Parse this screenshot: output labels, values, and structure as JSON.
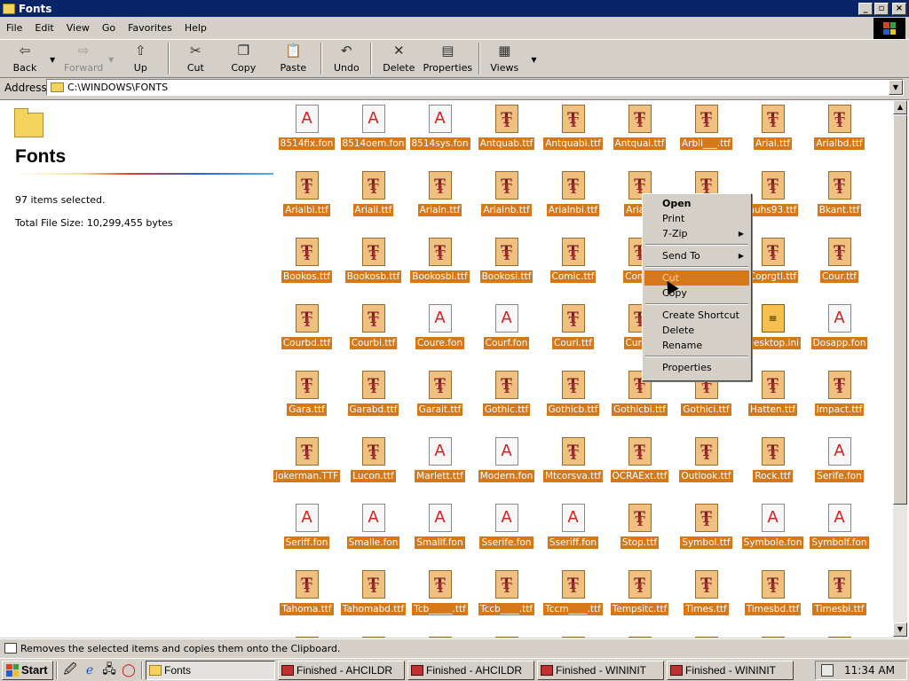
{
  "window": {
    "title": "Fonts"
  },
  "menu": [
    "File",
    "Edit",
    "View",
    "Go",
    "Favorites",
    "Help"
  ],
  "toolbar": {
    "back": "Back",
    "forward": "Forward",
    "up": "Up",
    "cut": "Cut",
    "copy": "Copy",
    "paste": "Paste",
    "undo": "Undo",
    "delete": "Delete",
    "properties": "Properties",
    "views": "Views"
  },
  "address": {
    "label": "Address",
    "value": "C:\\WINDOWS\\FONTS"
  },
  "left_pane": {
    "title": "Fonts",
    "selected": "97 items selected.",
    "total_size": "Total File Size: 10,299,455 bytes"
  },
  "files": [
    {
      "name": "8514fix.fon",
      "type": "fon"
    },
    {
      "name": "8514oem.fon",
      "type": "fon"
    },
    {
      "name": "8514sys.fon",
      "type": "fon"
    },
    {
      "name": "Antquab.ttf",
      "type": "ttf"
    },
    {
      "name": "Antquabi.ttf",
      "type": "ttf"
    },
    {
      "name": "Antquai.ttf",
      "type": "ttf"
    },
    {
      "name": "Arbli___.ttf",
      "type": "ttf"
    },
    {
      "name": "Arial.ttf",
      "type": "ttf"
    },
    {
      "name": "Arialbd.ttf",
      "type": "ttf"
    },
    {
      "name": "Arialbi.ttf",
      "type": "ttf"
    },
    {
      "name": "Ariali.ttf",
      "type": "ttf"
    },
    {
      "name": "Arialn.ttf",
      "type": "ttf"
    },
    {
      "name": "Arialnb.ttf",
      "type": "ttf"
    },
    {
      "name": "Arialnbi.ttf",
      "type": "ttf"
    },
    {
      "name": "Arialn",
      "type": "ttf"
    },
    {
      "name": "",
      "type": "ttf"
    },
    {
      "name": "auhs93.ttf",
      "type": "ttf"
    },
    {
      "name": "Bkant.ttf",
      "type": "ttf"
    },
    {
      "name": "Bookos.ttf",
      "type": "ttf"
    },
    {
      "name": "Bookosb.ttf",
      "type": "ttf"
    },
    {
      "name": "Bookosbi.ttf",
      "type": "ttf"
    },
    {
      "name": "Bookosi.ttf",
      "type": "ttf"
    },
    {
      "name": "Comic.ttf",
      "type": "ttf"
    },
    {
      "name": "Comic",
      "type": "ttf"
    },
    {
      "name": "",
      "type": "ttf"
    },
    {
      "name": "Coprgtl.ttf",
      "type": "ttf"
    },
    {
      "name": "Cour.ttf",
      "type": "ttf"
    },
    {
      "name": "Courbd.ttf",
      "type": "ttf"
    },
    {
      "name": "Courbi.ttf",
      "type": "ttf"
    },
    {
      "name": "Coure.fon",
      "type": "fon"
    },
    {
      "name": "Courf.fon",
      "type": "fon"
    },
    {
      "name": "Couri.ttf",
      "type": "ttf"
    },
    {
      "name": "Curlz_",
      "type": "ttf"
    },
    {
      "name": "",
      "type": "ttf"
    },
    {
      "name": "Desktop.ini",
      "type": "ini"
    },
    {
      "name": "Dosapp.fon",
      "type": "fon"
    },
    {
      "name": "Gara.ttf",
      "type": "ttf"
    },
    {
      "name": "Garabd.ttf",
      "type": "ttf"
    },
    {
      "name": "Garait.ttf",
      "type": "ttf"
    },
    {
      "name": "Gothic.ttf",
      "type": "ttf"
    },
    {
      "name": "Gothicb.ttf",
      "type": "ttf"
    },
    {
      "name": "Gothicbi.ttf",
      "type": "ttf"
    },
    {
      "name": "Gothici.ttf",
      "type": "ttf"
    },
    {
      "name": "Hatten.ttf",
      "type": "ttf"
    },
    {
      "name": "Impact.ttf",
      "type": "ttf"
    },
    {
      "name": "Jokerman.TTF",
      "type": "ttf"
    },
    {
      "name": "Lucon.ttf",
      "type": "ttf"
    },
    {
      "name": "Marlett.ttf",
      "type": "fon"
    },
    {
      "name": "Modern.fon",
      "type": "fon"
    },
    {
      "name": "Mtcorsva.ttf",
      "type": "ttf"
    },
    {
      "name": "OCRAExt.ttf",
      "type": "ttf"
    },
    {
      "name": "Outlook.ttf",
      "type": "ttf"
    },
    {
      "name": "Rock.ttf",
      "type": "ttf"
    },
    {
      "name": "Serife.fon",
      "type": "fon"
    },
    {
      "name": "Seriff.fon",
      "type": "fon"
    },
    {
      "name": "Smalle.fon",
      "type": "fon"
    },
    {
      "name": "Smallf.fon",
      "type": "fon"
    },
    {
      "name": "Sserife.fon",
      "type": "fon"
    },
    {
      "name": "Sseriff.fon",
      "type": "fon"
    },
    {
      "name": "Stop.ttf",
      "type": "ttf"
    },
    {
      "name": "Symbol.ttf",
      "type": "ttf"
    },
    {
      "name": "Symbole.fon",
      "type": "fon"
    },
    {
      "name": "Symbolf.fon",
      "type": "fon"
    },
    {
      "name": "Tahoma.ttf",
      "type": "ttf"
    },
    {
      "name": "Tahomabd.ttf",
      "type": "ttf"
    },
    {
      "name": "Tcb_____.ttf",
      "type": "ttf"
    },
    {
      "name": "Tccb____.ttf",
      "type": "ttf"
    },
    {
      "name": "Tccm____.ttf",
      "type": "ttf"
    },
    {
      "name": "Tempsitc.ttf",
      "type": "ttf"
    },
    {
      "name": "Times.ttf",
      "type": "ttf"
    },
    {
      "name": "Timesbd.ttf",
      "type": "ttf"
    },
    {
      "name": "Timesbi.ttf",
      "type": "ttf"
    }
  ],
  "context_menu": {
    "items": [
      {
        "label": "Open",
        "bold": true
      },
      {
        "label": "Print"
      },
      {
        "label": "7-Zip",
        "submenu": true
      },
      {
        "sep": true
      },
      {
        "label": "Send To",
        "submenu": true
      },
      {
        "sep": true
      },
      {
        "label": "Cut",
        "highlight": true
      },
      {
        "label": "Copy"
      },
      {
        "sep": true
      },
      {
        "label": "Create Shortcut"
      },
      {
        "label": "Delete"
      },
      {
        "label": "Rename"
      },
      {
        "sep": true
      },
      {
        "label": "Properties"
      }
    ]
  },
  "status": {
    "text": "Removes the selected items and copies them onto the Clipboard."
  },
  "taskbar": {
    "start": "Start",
    "tasks": [
      {
        "label": "Fonts",
        "active": true
      },
      {
        "label": "Finished - AHCILDR"
      },
      {
        "label": "Finished - AHCILDR"
      },
      {
        "label": "Finished - WININIT"
      },
      {
        "label": "Finished - WININIT"
      }
    ],
    "clock": "11:34 AM"
  },
  "colors": {
    "title_bg": "#0a246a",
    "selection": "#d4781a",
    "chrome": "#d4d0c8"
  }
}
